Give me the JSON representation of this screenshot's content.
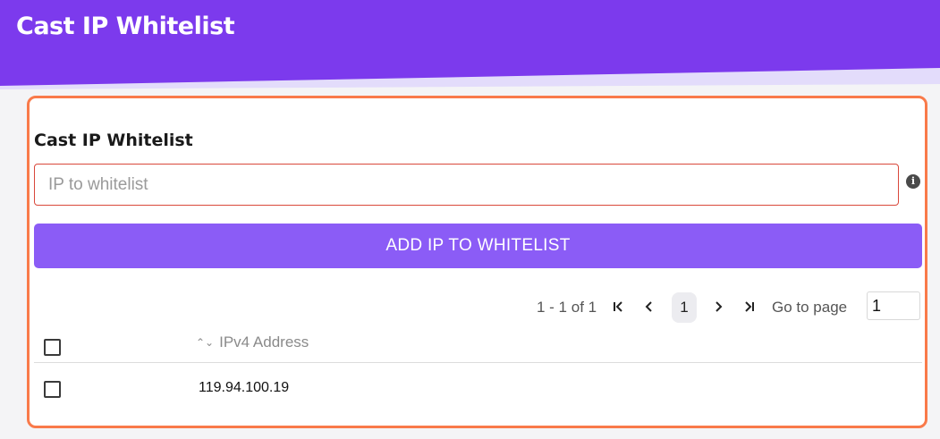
{
  "header": {
    "title": "Cast IP Whitelist",
    "band_color": "#7c3aed",
    "fade_color": "#e3dcfb"
  },
  "card": {
    "title": "Cast IP Whitelist",
    "border_color": "#f97a4a"
  },
  "ip_input": {
    "value": "",
    "placeholder": "IP to whitelist",
    "info_icon": "info-icon"
  },
  "add_button": {
    "label": "ADD IP TO WHITELIST",
    "color": "#8b5cf6"
  },
  "pagination": {
    "range": "1 - 1 of 1",
    "first_icon": "first-page-icon",
    "prev_icon": "prev-page-icon",
    "current_page": "1",
    "next_icon": "next-page-icon",
    "last_icon": "last-page-icon",
    "goto_label": "Go to page",
    "goto_value": "1"
  },
  "table": {
    "columns": [
      {
        "label": "",
        "type": "checkbox",
        "checked": false
      },
      {
        "label": "IPv4 Address",
        "sort_icon": "sort-icon"
      }
    ],
    "rows": [
      {
        "checked": false,
        "ip": "119.94.100.19"
      }
    ]
  }
}
